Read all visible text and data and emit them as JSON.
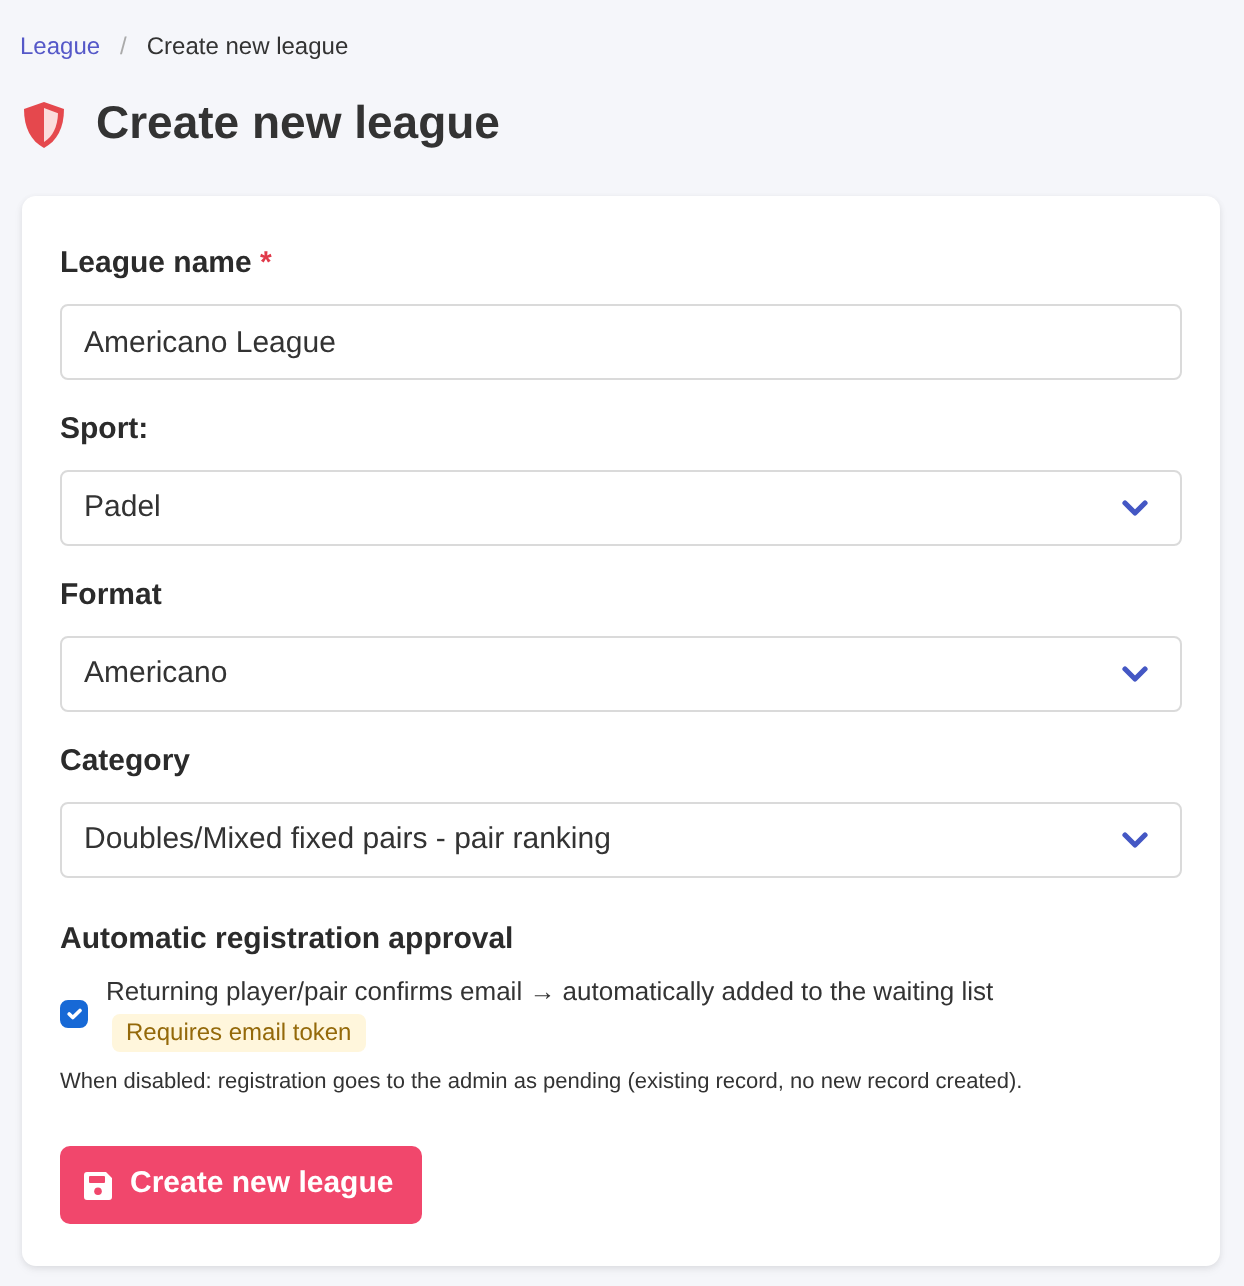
{
  "breadcrumb": {
    "items": [
      {
        "label": "League",
        "current": false
      },
      {
        "label": "Create new league",
        "current": true
      }
    ],
    "separator": "/"
  },
  "page_title": "Create new league",
  "form": {
    "fields": [
      {
        "kind": "text",
        "label": "League name",
        "required_mark": "*",
        "value": "Americano League"
      },
      {
        "kind": "select",
        "label": "Sport:",
        "value": "Padel"
      },
      {
        "kind": "select",
        "label": "Format",
        "value": "Americano"
      },
      {
        "kind": "select",
        "label": "Category",
        "value": "Doubles/Mixed fixed pairs - pair ranking"
      }
    ],
    "approval": {
      "heading": "Automatic registration approval",
      "checkbox": {
        "label": "Returning player/pair confirms email → automatically added to the waiting list",
        "checked": true,
        "badge": "Requires email token"
      },
      "help_text": "When disabled: registration goes to the admin as pending (existing record, no new record created)."
    },
    "submit_button": "Create new league"
  }
}
